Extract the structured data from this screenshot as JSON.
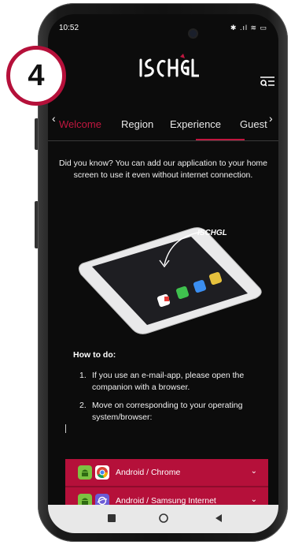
{
  "status": {
    "time": "10:52",
    "icons": "✱ .ıl ≋ ▭"
  },
  "tabs": [
    {
      "label": "Welcome",
      "active": true
    },
    {
      "label": "Region",
      "active": false
    },
    {
      "label": "Experience",
      "active": false
    },
    {
      "label": "Guest",
      "active": false
    }
  ],
  "info_text": "Did you know? You can add our application to your home screen to use it even without internet connection.",
  "howto": {
    "title": "How to do:",
    "steps": [
      {
        "num": "1.",
        "text": "If you use an e-mail-app, please open the companion with a browser."
      },
      {
        "num": "2.",
        "text": "Move on corresponding to your operating system/browser:"
      }
    ]
  },
  "accordion": [
    {
      "label": "Android / Chrome",
      "icons": [
        "android-icon",
        "chrome-icon"
      ]
    },
    {
      "label": "Android / Samsung Internet",
      "icons": [
        "android-icon",
        "samsung-internet-icon"
      ]
    }
  ],
  "badge": "4",
  "colors": {
    "accent": "#c0173f",
    "accordion": "#b5103a",
    "background": "#0c0c0c"
  }
}
